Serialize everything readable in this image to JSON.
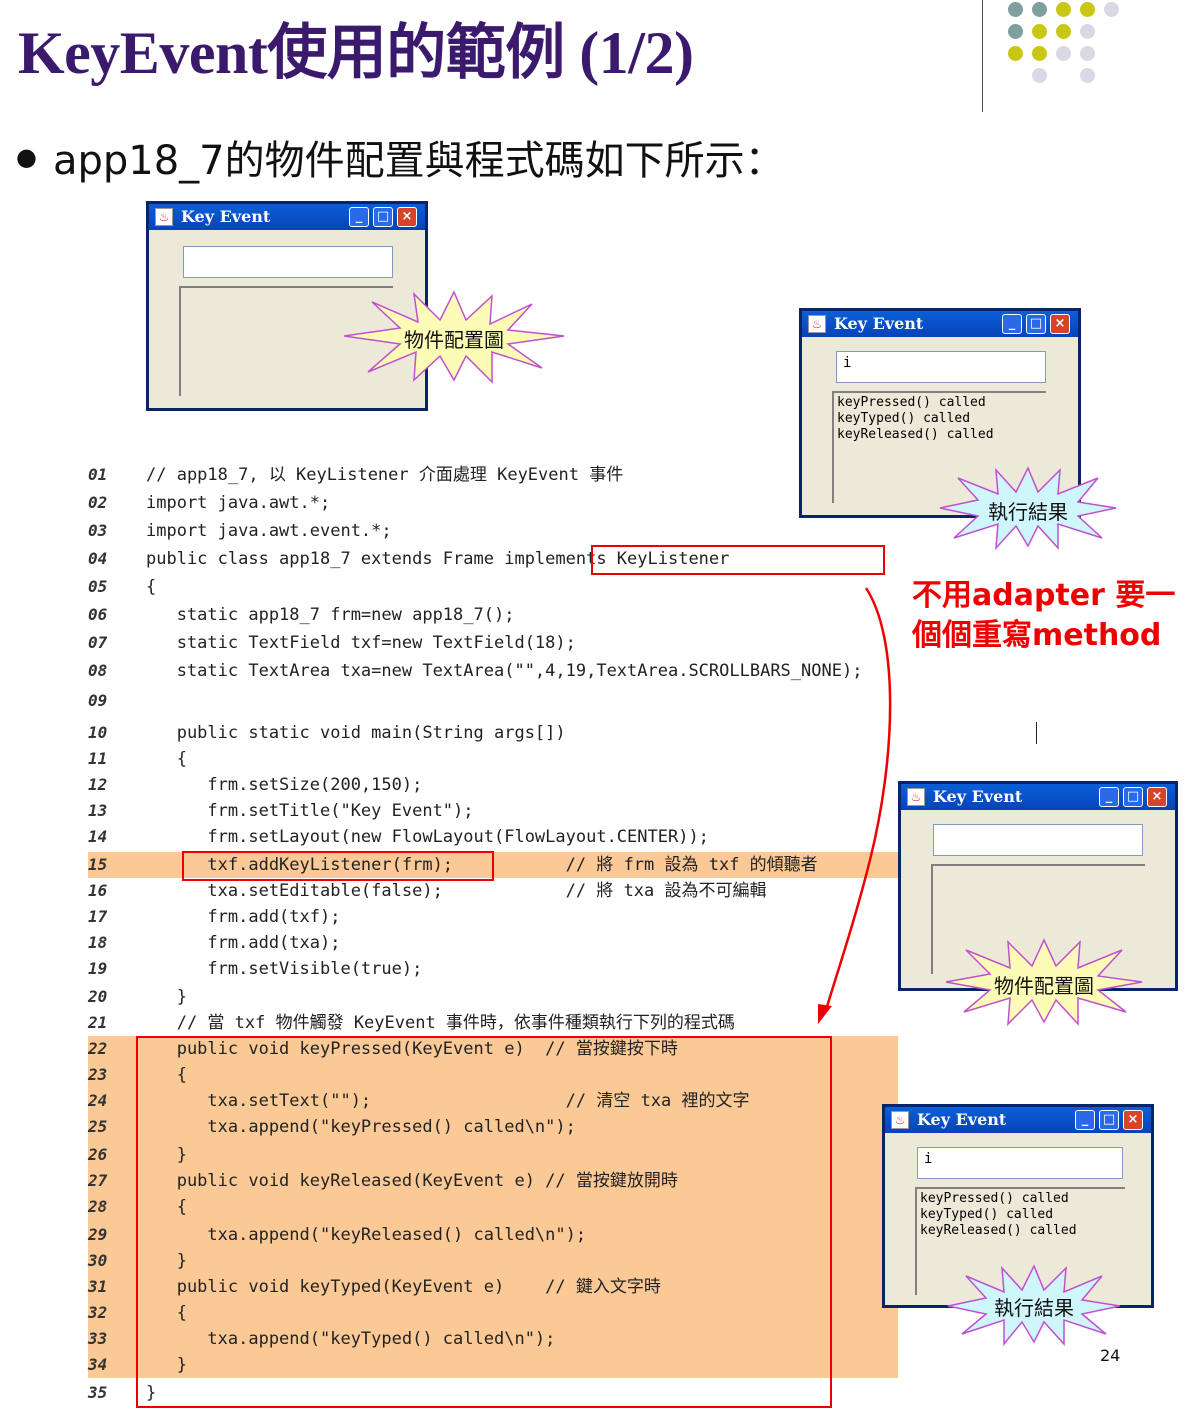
{
  "slide": {
    "title": "KeyEvent使用的範例 (1/2)",
    "bullet": "app18_7的物件配置與程式碼如下所示：",
    "page_number": "24",
    "note_line1": "不用adapter 要一",
    "note_line2": "個個重寫method"
  },
  "decor": {
    "dot_colors": [
      "#7f9fa0",
      "#c8c814",
      "#d9d9e6"
    ]
  },
  "windows": {
    "title": "Key Event",
    "typed_value": "i",
    "output_lines": [
      "keyPressed() called",
      "keyTyped() called",
      "keyReleased() called"
    ]
  },
  "labels": {
    "layout": "物件配置圖",
    "result": "執行結果"
  },
  "code": {
    "lines": [
      {
        "n": "01",
        "t": "// app18_7, 以 KeyListener 介面處理 KeyEvent 事件"
      },
      {
        "n": "02",
        "t": "import java.awt.*;"
      },
      {
        "n": "03",
        "t": "import java.awt.event.*;"
      },
      {
        "n": "04",
        "t": "public class app18_7 extends Frame implements KeyListener"
      },
      {
        "n": "05",
        "t": "{"
      },
      {
        "n": "06",
        "t": "   static app18_7 frm=new app18_7();"
      },
      {
        "n": "07",
        "t": "   static TextField txf=new TextField(18);"
      },
      {
        "n": "08",
        "t": "   static TextArea txa=new TextArea(\"\",4,19,TextArea.SCROLLBARS_NONE);"
      },
      {
        "n": "09",
        "t": ""
      },
      {
        "n": "10",
        "t": "   public static void main(String args[])"
      },
      {
        "n": "11",
        "t": "   {"
      },
      {
        "n": "12",
        "t": "      frm.setSize(200,150);"
      },
      {
        "n": "13",
        "t": "      frm.setTitle(\"Key Event\");"
      },
      {
        "n": "14",
        "t": "      frm.setLayout(new FlowLayout(FlowLayout.CENTER));"
      },
      {
        "n": "15",
        "t": "      txf.addKeyListener(frm);           // 將 frm 設為 txf 的傾聽者"
      },
      {
        "n": "16",
        "t": "      txa.setEditable(false);            // 將 txa 設為不可編輯"
      },
      {
        "n": "17",
        "t": "      frm.add(txf);"
      },
      {
        "n": "18",
        "t": "      frm.add(txa);"
      },
      {
        "n": "19",
        "t": "      frm.setVisible(true);"
      },
      {
        "n": "20",
        "t": "   }"
      },
      {
        "n": "21",
        "t": "   // 當 txf 物件觸發 KeyEvent 事件時，依事件種類執行下列的程式碼"
      },
      {
        "n": "22",
        "t": "   public void keyPressed(KeyEvent e)  // 當按鍵按下時"
      },
      {
        "n": "23",
        "t": "   {"
      },
      {
        "n": "24",
        "t": "      txa.setText(\"\");                   // 清空 txa 裡的文字"
      },
      {
        "n": "25",
        "t": "      txa.append(\"keyPressed() called\\n\");"
      },
      {
        "n": "26",
        "t": "   }"
      },
      {
        "n": "27",
        "t": "   public void keyReleased(KeyEvent e) // 當按鍵放開時"
      },
      {
        "n": "28",
        "t": "   {"
      },
      {
        "n": "29",
        "t": "      txa.append(\"keyReleased() called\\n\");"
      },
      {
        "n": "30",
        "t": "   }"
      },
      {
        "n": "31",
        "t": "   public void keyTyped(KeyEvent e)    // 鍵入文字時"
      },
      {
        "n": "32",
        "t": "   {"
      },
      {
        "n": "33",
        "t": "      txa.append(\"keyTyped() called\\n\");"
      },
      {
        "n": "34",
        "t": "   }"
      },
      {
        "n": "35",
        "t": "}"
      }
    ]
  }
}
